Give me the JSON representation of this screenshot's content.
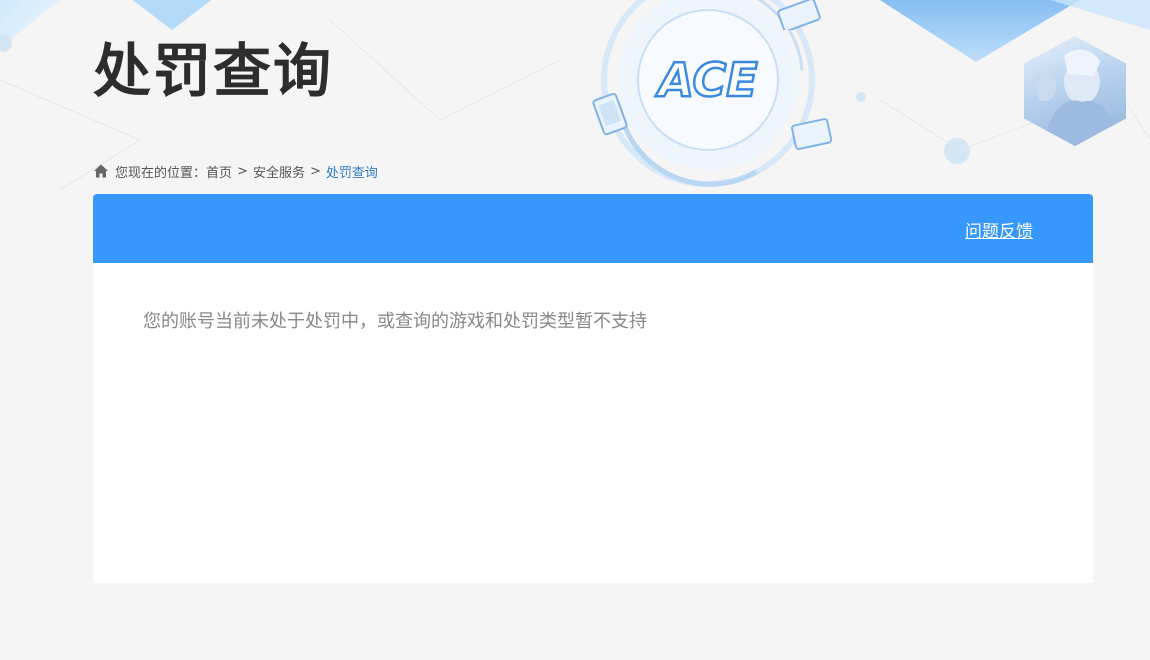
{
  "header": {
    "title": "处罚查询",
    "logo_text": "ACE"
  },
  "breadcrumb": {
    "prefix": "您现在的位置：",
    "items": [
      "首页",
      "安全服务"
    ],
    "separator": ">",
    "current": "处罚查询"
  },
  "panel": {
    "feedback_label": "问题反馈",
    "message": "您的账号当前未处于处罚中，或查询的游戏和处罚类型暂不支持"
  },
  "colors": {
    "accent": "#3697fd",
    "breadcrumb_current": "#2e7cc7",
    "title": "#2d2d2d",
    "message": "#888888",
    "background": "#f5f5f5"
  },
  "icons": [
    "home-icon",
    "ace-logo",
    "game-card-icon",
    "character-avatar"
  ]
}
